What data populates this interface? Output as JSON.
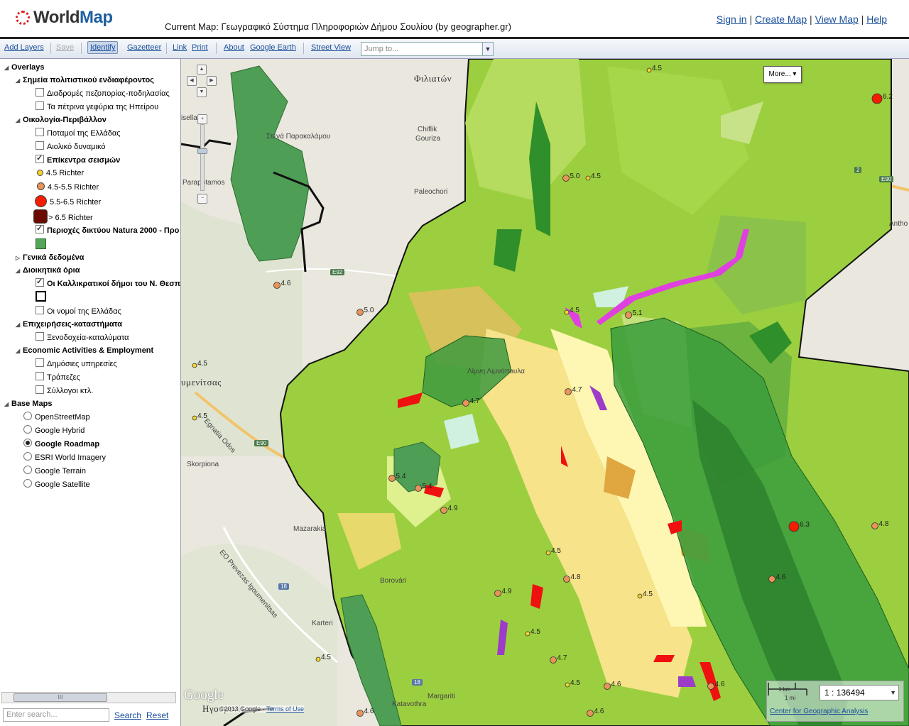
{
  "header": {
    "logo_text_a": "World",
    "logo_text_b": "Map",
    "current_map_label": "Current Map: Γεωγραφικό Σύστημα Πληροφοριών Δήμου Σουλίου (by geographer.gr)",
    "nav": {
      "sign_in": "Sign in",
      "create_map": "Create Map",
      "view_map": "View Map",
      "help": "Help",
      "separator": "|"
    }
  },
  "toolbar": {
    "add_layers": "Add Layers",
    "save": "Save",
    "identify": "Identify",
    "gazetteer": "Gazetteer",
    "link": "Link",
    "print": "Print",
    "about": "About",
    "google_earth": "Google Earth",
    "street_view": "Street View",
    "jump_placeholder": "Jump to..."
  },
  "layer_tree": {
    "overlays": "Overlays",
    "group1": "Σημεία πολιτιστικού ενδιαφέροντος",
    "g1_item1": "Διαδρομές πεζοπορίας-ποδηλασίας",
    "g1_item2": "Τα πέτρινα γεφύρια της Ηπείρου",
    "group2": "Οικολογία-Περιβάλλον",
    "g2_item1": "Ποταμοί της Ελλάδας",
    "g2_item2": "Αιολικό δυναμικό",
    "g2_item3": "Επίκεντρα σεισμών",
    "legend_45": "4.5 Richter",
    "legend_4555": "4.5-5.5 Richter",
    "legend_5565": "5.5-6.5 Richter",
    "legend_65": "> 6.5 Richter",
    "g2_item4": "Περιοχές δικτύου Natura 2000 - Προ",
    "group3": "Γενικά δεδομένα",
    "group4": "Διοικητικά όρια",
    "g4_item1": "Οι Καλλικρατικοί δήμοι του Ν. Θεσπ",
    "g4_item2": "Οι νομοί της Ελλάδας",
    "group5": "Επιχειρήσεις-καταστήματα",
    "g5_item1": "Ξενοδοχεία-καταλύματα",
    "group6": "Economic Activities & Employment",
    "g6_item1": "Δημόσιες υπηρεσίες",
    "g6_item2": "Τράπεζες",
    "g6_item3": "Σύλλογοι κτλ.",
    "base_maps": "Base Maps",
    "bm1": "OpenStreetMap",
    "bm2": "Google Hybrid",
    "bm3": "Google Roadmap",
    "bm4": "ESRI World Imagery",
    "bm5": "Google Terrain",
    "bm6": "Google Satellite",
    "search_placeholder": "Enter search...",
    "search": "Search",
    "reset": "Reset",
    "scroll_grip": "III"
  },
  "map": {
    "more": "More...",
    "labels": {
      "filiaton": "Φιλιατών",
      "chiflik": "Chiflik",
      "gouriza": "Gouriza",
      "paleochori": "Paleochori",
      "parapotamos": "Parapotamos",
      "stena": "Στενά Παρακαλάμου",
      "limni": "Λίμνη Λιμνόπουλα",
      "igoumenitsas": "υμενίτσας",
      "skorpiona": "Skorpiona",
      "mazarakia": "Mazarakia",
      "borovari": "Borovári",
      "karteri": "Karteri",
      "margariti": "Margariti",
      "katavothra": "Katavothra",
      "egnatia": "Egnatia Odos",
      "eo_prevezas": "EO Prevezas Igoumenitsas",
      "antho": "Antho",
      "eisella": "isella",
      "igoumenitsa_bottom": "Ηγουμενίτσα",
      "e90a": "E90",
      "e90b": "E90",
      "e92": "E92",
      "r2": "2",
      "r18a": "18",
      "r18b": "18"
    },
    "earthquakes": [
      "4.5",
      "6.2",
      "5.0",
      "4.5",
      "4.6",
      "5.0",
      "4.5",
      "5.1",
      "4.5",
      "4.5",
      "4.7",
      "4.7",
      "5.4",
      "5.4",
      "4.9",
      "4.5",
      "4.8",
      "4.9",
      "4.5",
      "4.5",
      "6.3",
      "4.8",
      "4.6",
      "4.5",
      "4.5",
      "4.7",
      "4.6",
      "4.6",
      "4.6",
      "4.6"
    ],
    "google": "Google",
    "copyright": "©2013 Google -",
    "terms": "Terms of Use",
    "scale_km": "1 km",
    "scale_mi": "1 mi",
    "scale_value": "1 : 136494",
    "cga": "Center for Geographic Analysis"
  }
}
